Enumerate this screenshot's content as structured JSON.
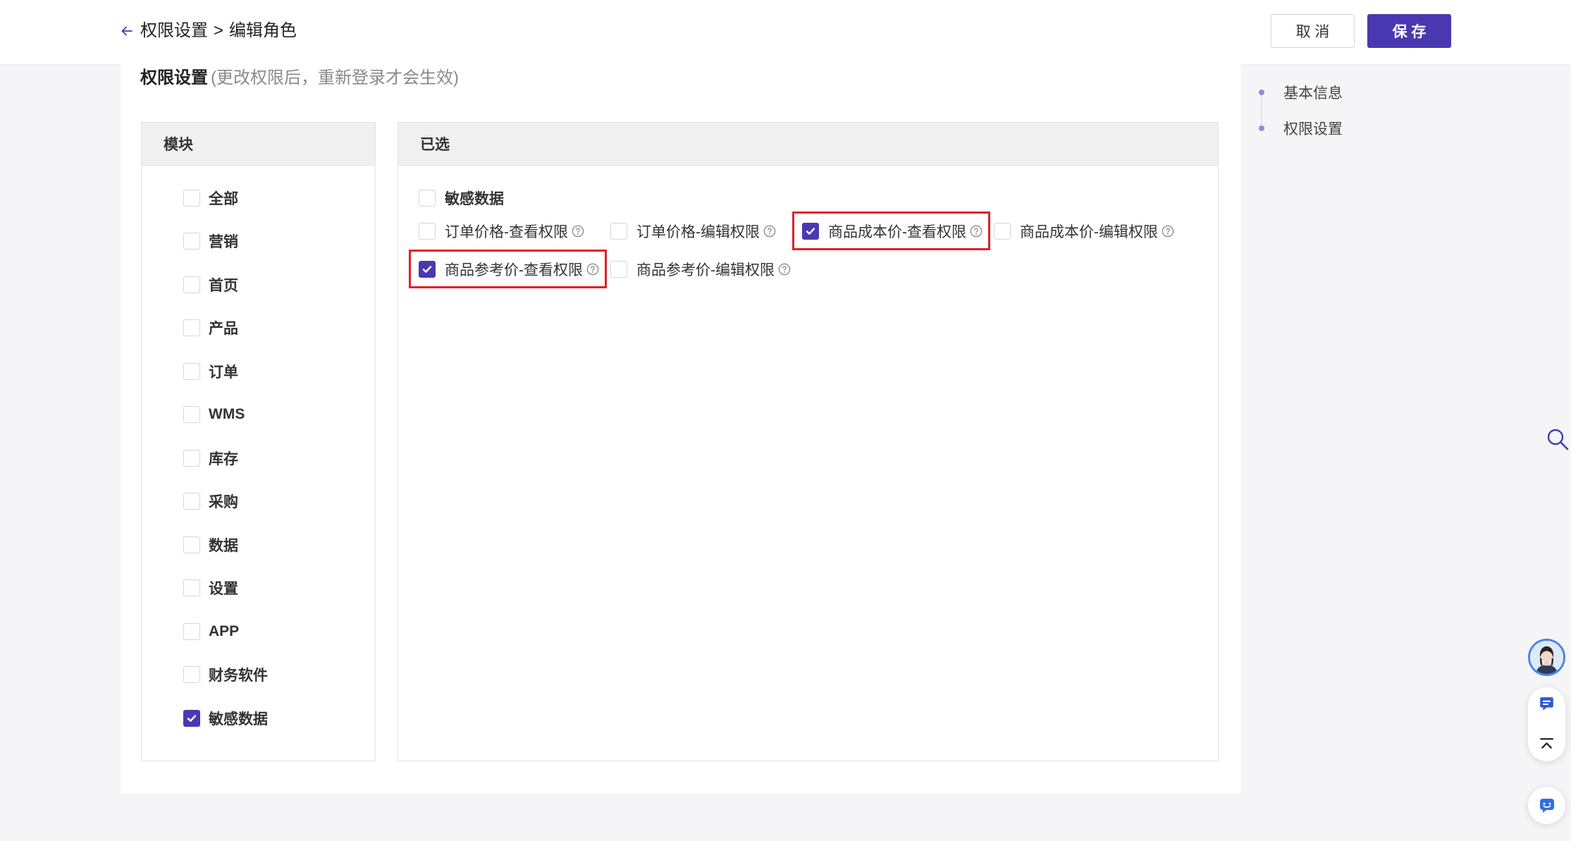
{
  "header": {
    "back_icon": "arrow-left-icon",
    "breadcrumb": {
      "parent": "权限设置",
      "separator": ">",
      "current": "编辑角色"
    },
    "cancel_label": "取 消",
    "save_label": "保 存"
  },
  "section": {
    "title": "权限设置",
    "hint": "(更改权限后，重新登录才会生效)"
  },
  "modules": {
    "header": "模块",
    "items": [
      {
        "label": "全部",
        "checked": false
      },
      {
        "label": "营销",
        "checked": false
      },
      {
        "label": "首页",
        "checked": false
      },
      {
        "label": "产品",
        "checked": false
      },
      {
        "label": "订单",
        "checked": false
      },
      {
        "label": "WMS",
        "checked": false
      },
      {
        "label": "库存",
        "checked": false
      },
      {
        "label": "采购",
        "checked": false
      },
      {
        "label": "数据",
        "checked": false
      },
      {
        "label": "设置",
        "checked": false
      },
      {
        "label": "APP",
        "checked": false
      },
      {
        "label": "财务软件",
        "checked": false
      },
      {
        "label": "敏感数据",
        "checked": true
      }
    ]
  },
  "selected": {
    "header": "已选",
    "group": {
      "label": "敏感数据",
      "checked": false
    },
    "permissions": [
      {
        "label": "订单价格-查看权限",
        "checked": false,
        "highlighted": false
      },
      {
        "label": "订单价格-编辑权限",
        "checked": false,
        "highlighted": false
      },
      {
        "label": "商品成本价-查看权限",
        "checked": true,
        "highlighted": true
      },
      {
        "label": "商品成本价-编辑权限",
        "checked": false,
        "highlighted": false
      },
      {
        "label": "商品参考价-查看权限",
        "checked": true,
        "highlighted": true
      },
      {
        "label": "商品参考价-编辑权限",
        "checked": false,
        "highlighted": false
      }
    ]
  },
  "anchor_nav": {
    "items": [
      {
        "label": "基本信息"
      },
      {
        "label": "权限设置"
      }
    ]
  },
  "floating_tools": {
    "search_icon": "search-icon",
    "avatar": "customer-service-avatar",
    "chat_icon": "chat-icon",
    "back_to_top_icon": "back-to-top-icon",
    "assistant_icon": "smile-bot-icon"
  },
  "icons": {
    "checkbox_check": "check-icon",
    "help": "question-circle-icon"
  },
  "colors": {
    "primary": "#4a38b2",
    "highlight": "#e31f2a",
    "page_bg": "#f5f5f7",
    "panel_header_bg": "#f0f0f0"
  }
}
